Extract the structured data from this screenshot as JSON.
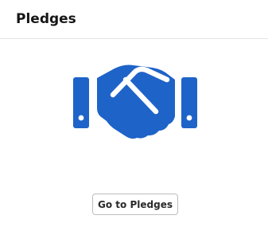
{
  "header": {
    "title": "Pledges"
  },
  "hero": {
    "icon": "handshake-icon",
    "color": "#1e63c8"
  },
  "actions": {
    "go_label": "Go to Pledges"
  }
}
